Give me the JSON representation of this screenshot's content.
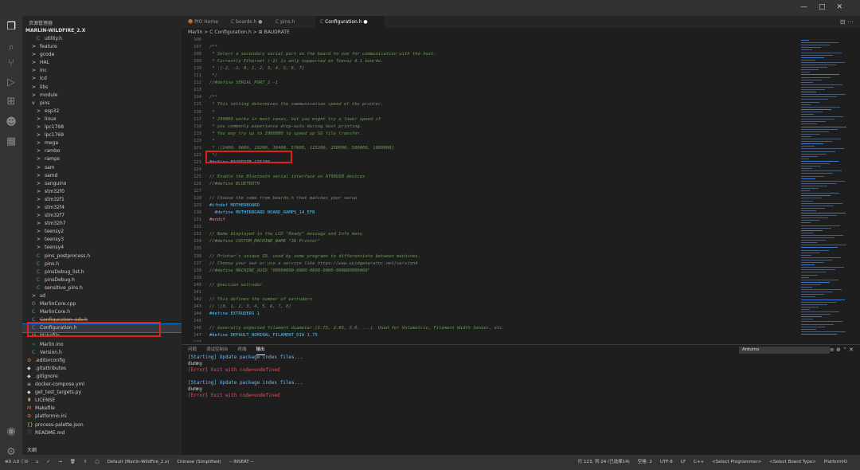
{
  "activity": {
    "icons": [
      "files-icon",
      "search-icon",
      "source-control-icon",
      "run-debug-icon",
      "extensions-icon",
      "platformio-icon",
      "database-icon",
      "account-icon",
      "settings-icon"
    ]
  },
  "sidebar": {
    "header": "资源管理器",
    "root": "MARLIN-WILDFIRE_2.X",
    "items": [
      {
        "label": "utility.h",
        "icon": "C",
        "indent": 2
      },
      {
        "label": "feature",
        "icon": ">",
        "indent": 1
      },
      {
        "label": "gcode",
        "icon": ">",
        "indent": 1
      },
      {
        "label": "HAL",
        "icon": ">",
        "indent": 1
      },
      {
        "label": "inc",
        "icon": ">",
        "indent": 1
      },
      {
        "label": "lcd",
        "icon": ">",
        "indent": 1
      },
      {
        "label": "libs",
        "icon": ">",
        "indent": 1
      },
      {
        "label": "module",
        "icon": ">",
        "indent": 1
      },
      {
        "label": "pins",
        "icon": "v",
        "indent": 1
      },
      {
        "label": "esp32",
        "icon": ">",
        "indent": 2
      },
      {
        "label": "linux",
        "icon": ">",
        "indent": 2
      },
      {
        "label": "lpc1768",
        "icon": ">",
        "indent": 2
      },
      {
        "label": "lpc1769",
        "icon": ">",
        "indent": 2
      },
      {
        "label": "mega",
        "icon": ">",
        "indent": 2
      },
      {
        "label": "rambo",
        "icon": ">",
        "indent": 2
      },
      {
        "label": "ramps",
        "icon": ">",
        "indent": 2
      },
      {
        "label": "sam",
        "icon": ">",
        "indent": 2
      },
      {
        "label": "samd",
        "icon": ">",
        "indent": 2
      },
      {
        "label": "sanguino",
        "icon": ">",
        "indent": 2
      },
      {
        "label": "stm32f0",
        "icon": ">",
        "indent": 2
      },
      {
        "label": "stm32f1",
        "icon": ">",
        "indent": 2
      },
      {
        "label": "stm32f4",
        "icon": ">",
        "indent": 2
      },
      {
        "label": "stm32f7",
        "icon": ">",
        "indent": 2
      },
      {
        "label": "stm32h7",
        "icon": ">",
        "indent": 2
      },
      {
        "label": "teensy2",
        "icon": ">",
        "indent": 2
      },
      {
        "label": "teensy3",
        "icon": ">",
        "indent": 2
      },
      {
        "label": "teensy4",
        "icon": ">",
        "indent": 2
      },
      {
        "label": "pins_postprocess.h",
        "icon": "C",
        "indent": 2
      },
      {
        "label": "pins.h",
        "icon": "C",
        "indent": 2
      },
      {
        "label": "pinsDebug_list.h",
        "icon": "C",
        "indent": 2
      },
      {
        "label": "pinsDebug.h",
        "icon": "C",
        "indent": 2
      },
      {
        "label": "sensitive_pins.h",
        "icon": "C",
        "indent": 2
      },
      {
        "label": "sd",
        "icon": ">",
        "indent": 1
      },
      {
        "label": "MarlinCore.cpp",
        "icon": "G",
        "indent": 1
      },
      {
        "label": "MarlinCore.h",
        "icon": "C",
        "indent": 1
      },
      {
        "label": "Configuration_adv.h",
        "icon": "C",
        "indent": 1
      },
      {
        "label": "Configuration.h",
        "icon": "C",
        "indent": 1,
        "selected": true
      },
      {
        "label": "Makefile",
        "icon": "M",
        "indent": 1
      },
      {
        "label": "Marlin.ino",
        "icon": "∞",
        "indent": 1
      },
      {
        "label": "Version.h",
        "icon": "C",
        "indent": 1
      },
      {
        "label": ".editorconfig",
        "icon": "⚙",
        "indent": 0
      },
      {
        "label": ".gitattributes",
        "icon": "◆",
        "indent": 0
      },
      {
        "label": ".gitignore",
        "icon": "◆",
        "indent": 0
      },
      {
        "label": "docker-compose.yml",
        "icon": "≡",
        "indent": 0
      },
      {
        "label": "get_test_targets.py",
        "icon": "◆",
        "indent": 0
      },
      {
        "label": "LICENSE",
        "icon": "♜",
        "indent": 0
      },
      {
        "label": "Makefile",
        "icon": "M",
        "indent": 0
      },
      {
        "label": "platformio.ini",
        "icon": "⚙",
        "indent": 0
      },
      {
        "label": "process-palette.json",
        "icon": "{}",
        "indent": 0
      },
      {
        "label": "README.md",
        "icon": "ⓘ",
        "indent": 0
      }
    ],
    "outline": "大纲"
  },
  "tabs": [
    {
      "label": "PIO Home",
      "icon": "☻",
      "active": false
    },
    {
      "label": "boards.h",
      "icon": "C",
      "active": false,
      "modified": true
    },
    {
      "label": "pins.h",
      "icon": "C",
      "active": false
    },
    {
      "label": "Configuration.h",
      "icon": "C",
      "active": true,
      "modified": true
    }
  ],
  "breadcrumb": "Marlin > C Configuration.h > ⊞ BAUDRATE",
  "editor": {
    "lines": [
      {
        "n": "106",
        "t": "",
        "k": "plain"
      },
      {
        "n": "107",
        "t": "/**",
        "k": "com"
      },
      {
        "n": "108",
        "t": " * Select a secondary serial port on the board to use for communication with the host.",
        "k": "com"
      },
      {
        "n": "109",
        "t": " * Currently Ethernet (-2) is only supported on Teensy 4.1 boards.",
        "k": "com"
      },
      {
        "n": "110",
        "t": " * :[-2, -1, 0, 1, 2, 3, 4, 5, 6, 7]",
        "k": "com"
      },
      {
        "n": "111",
        "t": " */",
        "k": "com"
      },
      {
        "n": "112",
        "t": "//#define SERIAL_PORT_2 -1",
        "k": "com"
      },
      {
        "n": "113",
        "t": "",
        "k": "plain"
      },
      {
        "n": "114",
        "t": "/**",
        "k": "com"
      },
      {
        "n": "115",
        "t": " * This setting determines the communication speed of the printer.",
        "k": "com"
      },
      {
        "n": "116",
        "t": " *",
        "k": "com"
      },
      {
        "n": "117",
        "t": " * 250000 works in most cases, but you might try a lower speed if",
        "k": "com"
      },
      {
        "n": "118",
        "t": " * you commonly experience drop-outs during host printing.",
        "k": "com"
      },
      {
        "n": "119",
        "t": " * You may try up to 1000000 to speed up SD file transfer.",
        "k": "com"
      },
      {
        "n": "120",
        "t": " *",
        "k": "com"
      },
      {
        "n": "121",
        "t": " * :[2400, 9600, 19200, 38400, 57600, 115200, 250000, 500000, 1000000]",
        "k": "com"
      },
      {
        "n": "122",
        "t": " */",
        "k": "com"
      },
      {
        "n": "123",
        "t": "#define BAUDRATE 115200",
        "k": "def"
      },
      {
        "n": "124",
        "t": "",
        "k": "plain"
      },
      {
        "n": "125",
        "t": "// Enable the Bluetooth serial interface on AT90USB devices",
        "k": "com"
      },
      {
        "n": "126",
        "t": "//#define BLUETOOTH",
        "k": "com"
      },
      {
        "n": "127",
        "t": "",
        "k": "plain"
      },
      {
        "n": "128",
        "t": "// Choose the name from boards.h that matches your setup",
        "k": "com"
      },
      {
        "n": "129",
        "t": "#ifndef MOTHERBOARD",
        "k": "def"
      },
      {
        "n": "130",
        "t": "  #define MOTHERBOARD BOARD_RAMPS_14_EFB",
        "k": "def"
      },
      {
        "n": "131",
        "t": "#endif",
        "k": "pp"
      },
      {
        "n": "132",
        "t": "",
        "k": "plain"
      },
      {
        "n": "133",
        "t": "// Name displayed in the LCD \"Ready\" message and Info menu",
        "k": "com"
      },
      {
        "n": "134",
        "t": "//#define CUSTOM_MACHINE_NAME \"3D Printer\"",
        "k": "com"
      },
      {
        "n": "135",
        "t": "",
        "k": "plain"
      },
      {
        "n": "136",
        "t": "// Printer's unique ID, used by some programs to differentiate between machines.",
        "k": "com"
      },
      {
        "n": "137",
        "t": "// Choose your own or use a service like https://www.uuidgenerator.net/version4",
        "k": "com"
      },
      {
        "n": "138",
        "t": "//#define MACHINE_UUID \"00000000-0000-0000-0000-000000000000\"",
        "k": "com"
      },
      {
        "n": "139",
        "t": "",
        "k": "plain"
      },
      {
        "n": "140",
        "t": "// @section extruder",
        "k": "com"
      },
      {
        "n": "141",
        "t": "",
        "k": "plain"
      },
      {
        "n": "142",
        "t": "// This defines the number of extruders",
        "k": "com"
      },
      {
        "n": "143",
        "t": "// :[0, 1, 2, 3, 4, 5, 6, 7, 8]",
        "k": "com"
      },
      {
        "n": "144",
        "t": "#define EXTRUDERS 1",
        "k": "def"
      },
      {
        "n": "145",
        "t": "",
        "k": "plain"
      },
      {
        "n": "146",
        "t": "// Generally expected filament diameter (1.75, 2.85, 3.0, ...). Used for Volumetric, Filament Width Sensor, etc.",
        "k": "com"
      },
      {
        "n": "147",
        "t": "#define DEFAULT_NOMINAL_FILAMENT_DIA 1.75",
        "k": "def"
      },
      {
        "n": "148",
        "t": "",
        "k": "plain"
      },
      {
        "n": "149",
        "t": "// For Cyclops or any \"multi-extruder\" that shares a single nozzle.",
        "k": "com"
      }
    ]
  },
  "panel": {
    "tabs": [
      {
        "label": "问题",
        "active": false
      },
      {
        "label": "调试控制台",
        "active": false
      },
      {
        "label": "终端",
        "active": false
      },
      {
        "label": "输出",
        "active": true
      }
    ],
    "channel": "Arduino",
    "output": [
      {
        "text": "[Starting] Update package index files...",
        "kind": "start"
      },
      {
        "text": "dummy",
        "kind": "plain"
      },
      {
        "text": "[Error] Exit with code=undefined",
        "kind": "error"
      },
      {
        "text": "",
        "kind": "plain"
      },
      {
        "text": "[Starting] Update package index files...",
        "kind": "start"
      },
      {
        "text": "dummy",
        "kind": "plain"
      },
      {
        "text": "[Error] Exit with code=undefined",
        "kind": "error"
      }
    ]
  },
  "status": {
    "left": [
      "⊗0 ⚠0 ⓘ0",
      "⌂",
      "✓",
      "→",
      "🗑",
      "⇧",
      "▢",
      "Default (Marlin-WildFire_2.x)",
      "Chinese (Simplified)",
      "-- INSERT --"
    ],
    "right": [
      "行 123, 列 24 (已选择14)",
      "空格: 2",
      "UTF-8",
      "LF",
      "C++",
      "<Select Programmer>",
      "<Select Board Type>",
      "PlatformIO"
    ]
  }
}
